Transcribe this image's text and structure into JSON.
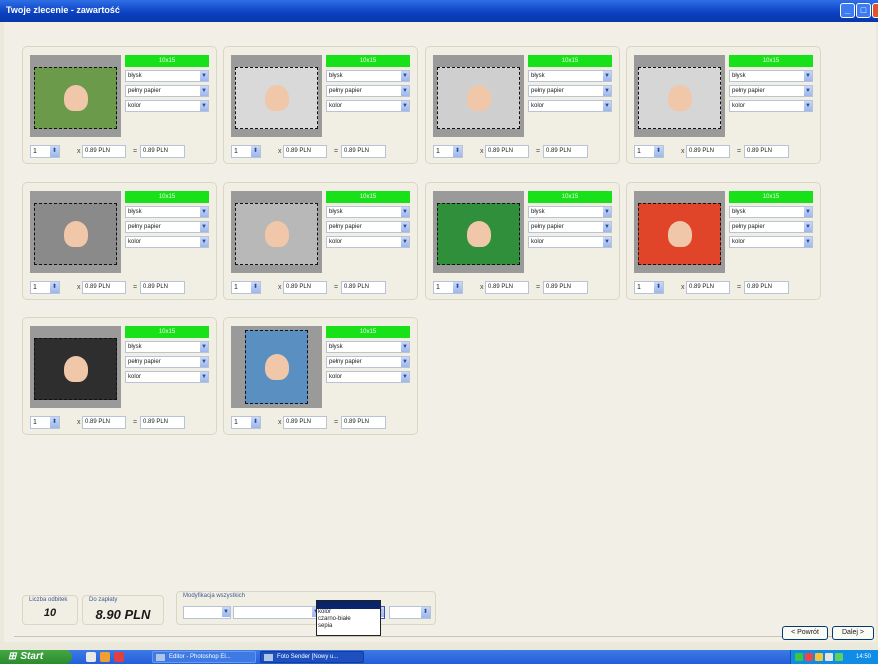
{
  "window": {
    "title": "Twoje zlecenie - zawartość"
  },
  "cards": [
    {
      "size": "10x15",
      "finish": "błysk",
      "paper": "pełny papier",
      "color": "kolor",
      "qty": "1",
      "unit_price": "0.89 PLN",
      "total": "0.89 PLN",
      "photo_bg": "#6a9a4a",
      "portrait": false
    },
    {
      "size": "10x15",
      "finish": "błysk",
      "paper": "pełny papier",
      "color": "kolor",
      "qty": "1",
      "unit_price": "0.89 PLN",
      "total": "0.89 PLN",
      "photo_bg": "#d9d9d9",
      "portrait": false
    },
    {
      "size": "10x15",
      "finish": "błysk",
      "paper": "pełny papier",
      "color": "kolor",
      "qty": "1",
      "unit_price": "0.89 PLN",
      "total": "0.89 PLN",
      "photo_bg": "#cfcfcf",
      "portrait": false
    },
    {
      "size": "10x15",
      "finish": "błysk",
      "paper": "pełny papier",
      "color": "kolor",
      "qty": "1",
      "unit_price": "0.89 PLN",
      "total": "0.89 PLN",
      "photo_bg": "#d6d6d6",
      "portrait": false
    },
    {
      "size": "10x15",
      "finish": "błysk",
      "paper": "pełny papier",
      "color": "kolor",
      "qty": "1",
      "unit_price": "0.89 PLN",
      "total": "0.89 PLN",
      "photo_bg": "#8a8a8a",
      "portrait": false
    },
    {
      "size": "10x15",
      "finish": "błysk",
      "paper": "pełny papier",
      "color": "kolor",
      "qty": "1",
      "unit_price": "0.89 PLN",
      "total": "0.89 PLN",
      "photo_bg": "#b8b8b8",
      "portrait": false
    },
    {
      "size": "10x15",
      "finish": "błysk",
      "paper": "pełny papier",
      "color": "kolor",
      "qty": "1",
      "unit_price": "0.89 PLN",
      "total": "0.89 PLN",
      "photo_bg": "#2f8f3a",
      "portrait": false
    },
    {
      "size": "10x15",
      "finish": "błysk",
      "paper": "pełny papier",
      "color": "kolor",
      "qty": "1",
      "unit_price": "0.89 PLN",
      "total": "0.89 PLN",
      "photo_bg": "#e0452a",
      "portrait": false
    },
    {
      "size": "10x15",
      "finish": "błysk",
      "paper": "pełny papier",
      "color": "kolor",
      "qty": "1",
      "unit_price": "0.89 PLN",
      "total": "0.89 PLN",
      "photo_bg": "#2e2e2e",
      "portrait": false
    },
    {
      "size": "10x15",
      "finish": "błysk",
      "paper": "pełny papier",
      "color": "kolor",
      "qty": "1",
      "unit_price": "0.89 PLN",
      "total": "0.89 PLN",
      "photo_bg": "#5a8fc2",
      "portrait": true
    }
  ],
  "summary": {
    "count_label": "Liczba odbitek",
    "count": "10",
    "pay_label": "Do zapłaty",
    "pay": "8.90 PLN"
  },
  "modify_all": {
    "label": "Modyfikacja wszystkich",
    "options": [
      "kolor",
      "czarno-białe",
      "sepia"
    ]
  },
  "nav": {
    "back": "< Powrót",
    "next": "Dalej >"
  },
  "taskbar": {
    "start": "Start",
    "tasks": [
      "Editor - Photoshop El...",
      "Foto Sender [Nowy u..."
    ],
    "clock": "14:50"
  }
}
